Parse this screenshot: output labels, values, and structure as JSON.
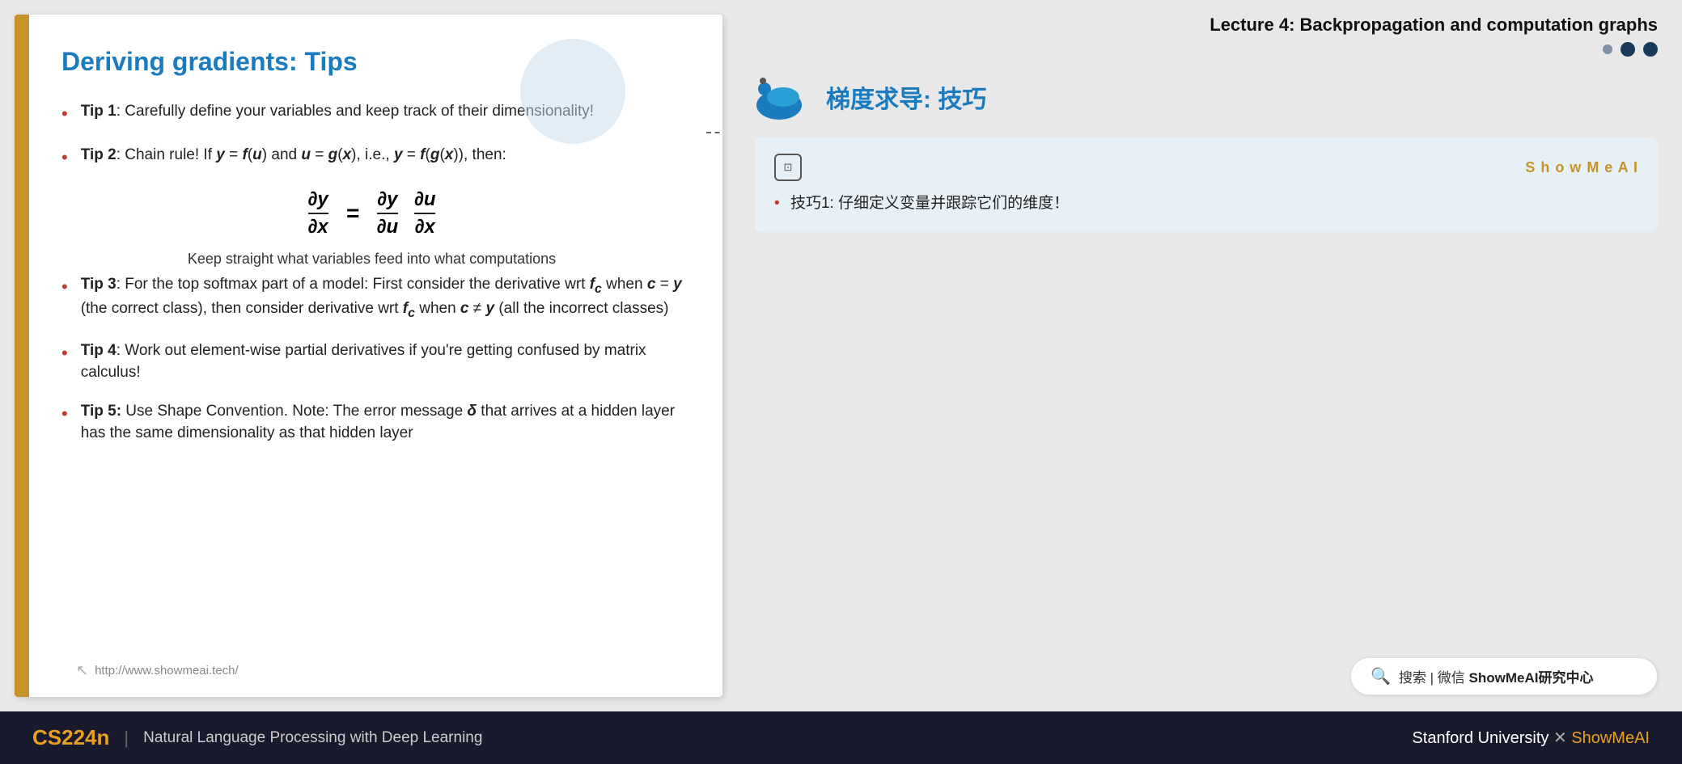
{
  "lecture": {
    "title": "Lecture 4:  Backpropagation and computation graphs"
  },
  "slide": {
    "title": "Deriving gradients: Tips",
    "tips": [
      {
        "label": "Tip 1",
        "text": ": Carefully define your variables and keep track of their dimensionality!"
      },
      {
        "label": "Tip 2",
        "text": ": Chain rule! If y = f(u) and u = g(x), i.e., y = f(g(x)), then:",
        "hasFormula": true,
        "formulaNote": "Keep straight what variables feed into what computations"
      },
      {
        "label": "Tip 3",
        "text": ": For the top softmax part of a model: First consider the derivative wrt fc when c = y (the correct class), then consider derivative wrt fc when c ≠ y (all the incorrect classes)"
      },
      {
        "label": "Tip 4",
        "text": ": Work out element-wise partial derivatives if you're getting confused by matrix calculus!"
      },
      {
        "label": "Tip 5",
        "text": ": Use Shape Convention. Note: The error message δ that arrives at a hidden layer has the same dimensionality as that hidden layer"
      }
    ],
    "url": "http://www.showmeai.tech/"
  },
  "chinese_section": {
    "title": "梯度求导: 技巧",
    "translation_card": {
      "brand": "S h o w M e A I",
      "content": "技巧1: 仔细定义变量并跟踪它们的维度！"
    }
  },
  "search": {
    "text": "搜索 | 微信 ShowMeAI研究中心"
  },
  "nav_dots": {
    "filled": 3
  },
  "bottom_bar": {
    "course_code": "CS224n",
    "divider": "|",
    "course_name": "Natural Language Processing with Deep Learning",
    "university": "Stanford University",
    "x_mark": "✕",
    "brand": "ShowMeAI"
  }
}
